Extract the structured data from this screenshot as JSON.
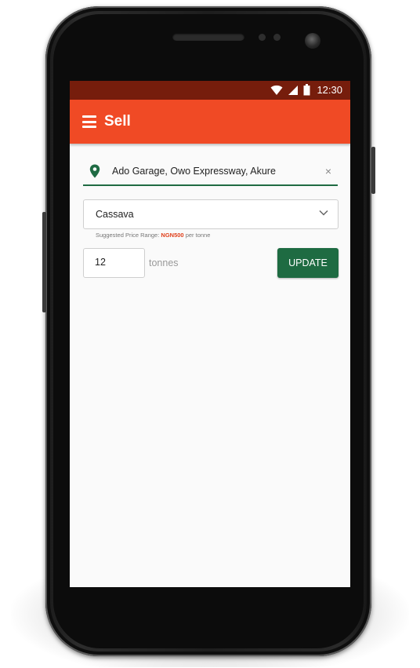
{
  "status_bar": {
    "time": "12:30",
    "icons": [
      "wifi-icon",
      "cell-signal-icon",
      "battery-icon"
    ]
  },
  "app_bar": {
    "title": "Sell",
    "menu_icon": "hamburger-menu-icon"
  },
  "location": {
    "value": "Ado Garage, Owo Expressway, Akure",
    "icon": "location-pin-icon",
    "clear": "×"
  },
  "crop_select": {
    "value": "Cassava"
  },
  "price_hint": {
    "prefix": "Suggested Price Range:",
    "price": "NGN500",
    "suffix": "per tonne"
  },
  "quantity": {
    "value": "12",
    "unit": "tonnes"
  },
  "update_button": {
    "label": "UPDATE"
  },
  "colors": {
    "status_bar": "#761d0c",
    "app_bar": "#f04a25",
    "accent_green": "#1e6b42",
    "price": "#e0401c"
  }
}
